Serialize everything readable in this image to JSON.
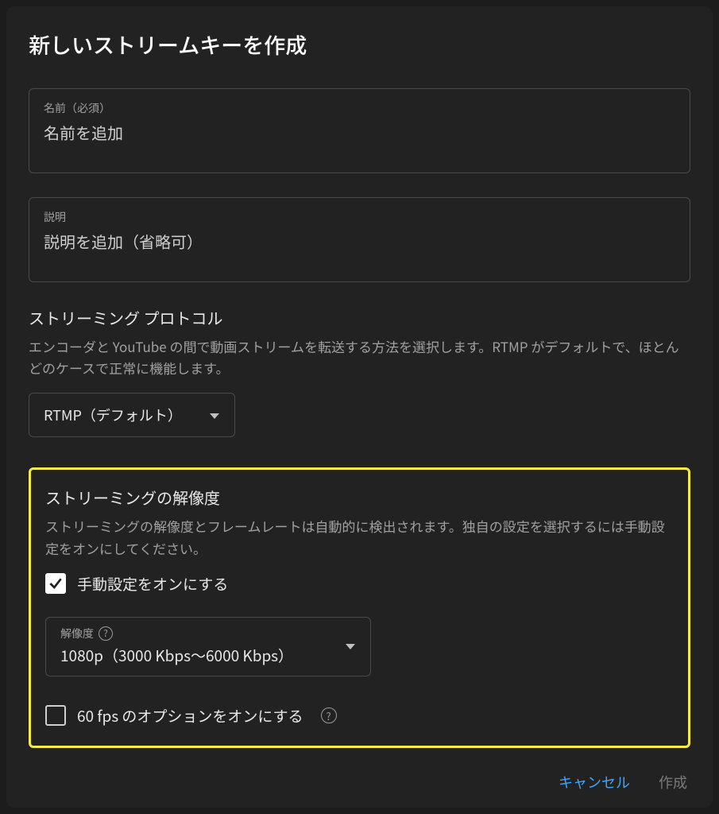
{
  "dialog": {
    "title": "新しいストリームキーを作成"
  },
  "name_field": {
    "label": "名前（必須）",
    "placeholder": "名前を追加"
  },
  "description_field": {
    "label": "説明",
    "placeholder": "説明を追加（省略可）"
  },
  "protocol": {
    "title": "ストリーミング プロトコル",
    "description": "エンコーダと YouTube の間で動画ストリームを転送する方法を選択します。RTMP がデフォルトで、ほとんどのケースで正常に機能します。",
    "selected": "RTMP（デフォルト）"
  },
  "resolution": {
    "title": "ストリーミングの解像度",
    "description": "ストリーミングの解像度とフレームレートは自動的に検出されます。独自の設定を選択するには手動設定をオンにしてください。",
    "manual_checkbox_label": "手動設定をオンにする",
    "manual_checked": true,
    "dropdown_label": "解像度",
    "dropdown_value": "1080p（3000 Kbps～6000 Kbps）",
    "fps_checkbox_label": "60 fps のオプションをオンにする",
    "fps_checked": false
  },
  "footer": {
    "cancel": "キャンセル",
    "create": "作成"
  }
}
